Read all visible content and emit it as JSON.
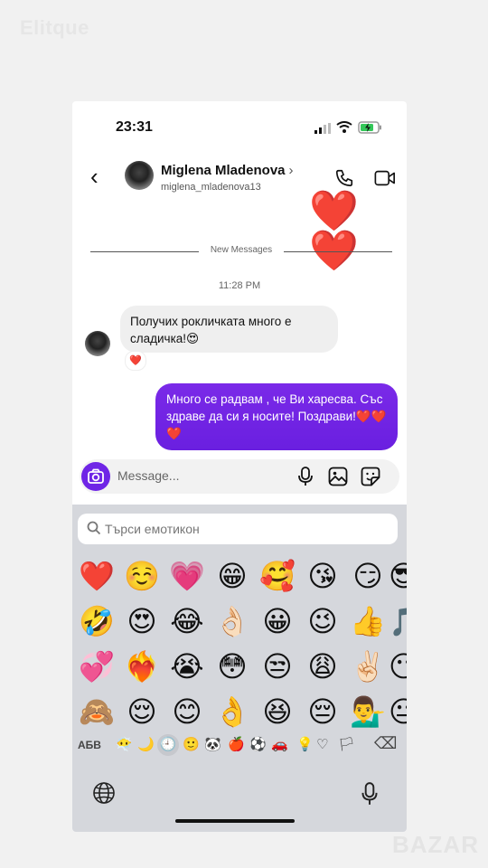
{
  "watermark": "Elitque",
  "bazar_logo": "BAZAR",
  "status_bar": {
    "time": "23:31"
  },
  "header": {
    "name": "Miglena Mladenova",
    "chevron": "›",
    "username": "miglena_mladenova13"
  },
  "messages": {
    "top_hearts": "❤️❤️",
    "divider_label": "New Messages",
    "timestamp": "11:28 PM",
    "incoming_text": "Получих рокличката много е сладичка!😍",
    "incoming_reaction": "❤️",
    "outgoing_text": "Много се радвам , че Ви харесва. Със здраве да си я носите! Поздрави!",
    "outgoing_hearts": "❤️❤️❤️"
  },
  "composer": {
    "placeholder": "Message..."
  },
  "emoji_keyboard": {
    "search_placeholder": "Търси емотикон",
    "abc_label": "АБВ",
    "rows": [
      [
        "❤️",
        "☺️",
        "💗",
        "😁",
        "🥰",
        "😘",
        "😏",
        "😎"
      ],
      [
        "🤣",
        "😍",
        "😂",
        "👌🏻",
        "😀",
        "😉",
        "👍",
        "🎵"
      ],
      [
        "💞",
        "❤️‍🔥",
        "😭",
        "😳",
        "😒",
        "😩",
        "✌🏻",
        "😶"
      ],
      [
        "🙈",
        "😌",
        "😊",
        "👌",
        "😆",
        "😔",
        "💁‍♂️",
        "😐"
      ]
    ],
    "categories": [
      "😶‍🌫️",
      "🌙",
      "🕘",
      "🙂",
      "🐼",
      "🍎",
      "⚽",
      "🚗",
      "💡",
      "♡",
      "🏳",
      "⌫"
    ]
  },
  "colors": {
    "accent": "#6f25e6",
    "heart": "#e0201e"
  }
}
